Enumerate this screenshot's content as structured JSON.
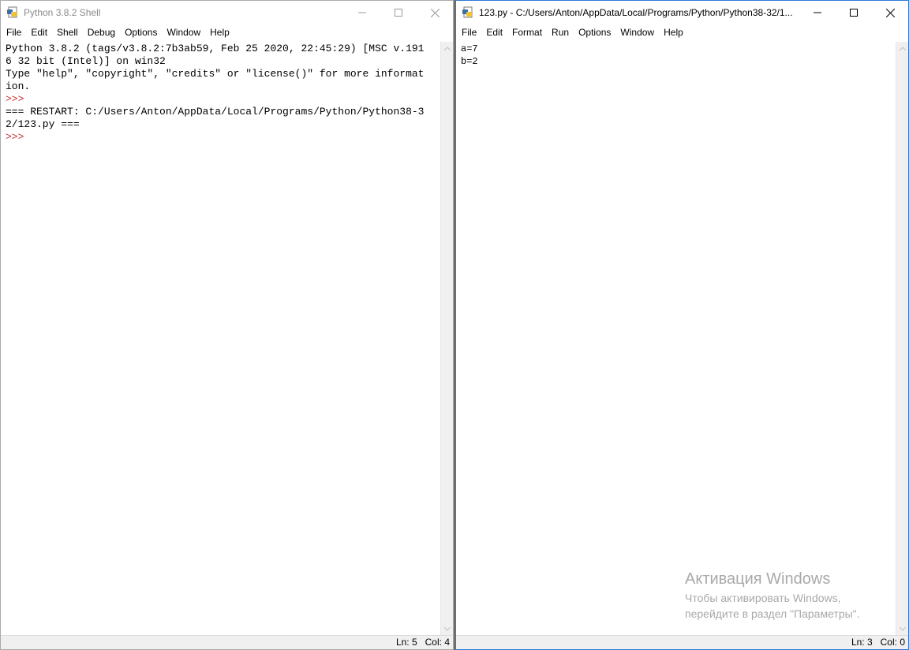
{
  "shell_window": {
    "title": "Python 3.8.2 Shell",
    "menu": [
      "File",
      "Edit",
      "Shell",
      "Debug",
      "Options",
      "Window",
      "Help"
    ],
    "lines": [
      {
        "text": "Python 3.8.2 (tags/v3.8.2:7b3ab59, Feb 25 2020, 22:45:29) [MSC v.191",
        "kind": "output"
      },
      {
        "text": "6 32 bit (Intel)] on win32",
        "kind": "output"
      },
      {
        "text": "Type \"help\", \"copyright\", \"credits\" or \"license()\" for more informat",
        "kind": "output"
      },
      {
        "text": "ion.",
        "kind": "output"
      },
      {
        "text": ">>> ",
        "kind": "prompt"
      },
      {
        "text": "=== RESTART: C:/Users/Anton/AppData/Local/Programs/Python/Python38-3",
        "kind": "output"
      },
      {
        "text": "2/123.py ===",
        "kind": "output"
      },
      {
        "text": ">>> ",
        "kind": "prompt"
      }
    ],
    "status": {
      "ln": "Ln: 5",
      "col": "Col: 4"
    }
  },
  "editor_window": {
    "title": "123.py - C:/Users/Anton/AppData/Local/Programs/Python/Python38-32/1...",
    "menu": [
      "File",
      "Edit",
      "Format",
      "Run",
      "Options",
      "Window",
      "Help"
    ],
    "lines": [
      "a=7",
      "b=2"
    ],
    "status": {
      "ln": "Ln: 3",
      "col": "Col: 0"
    }
  },
  "watermark": {
    "title": "Активация Windows",
    "line1": "Чтобы активировать Windows,",
    "line2": "перейдите в раздел \"Параметры\"."
  },
  "colors": {
    "prompt": "#c33333",
    "active_border": "#2b7bd6",
    "inactive_title": "#8a8a8a"
  }
}
